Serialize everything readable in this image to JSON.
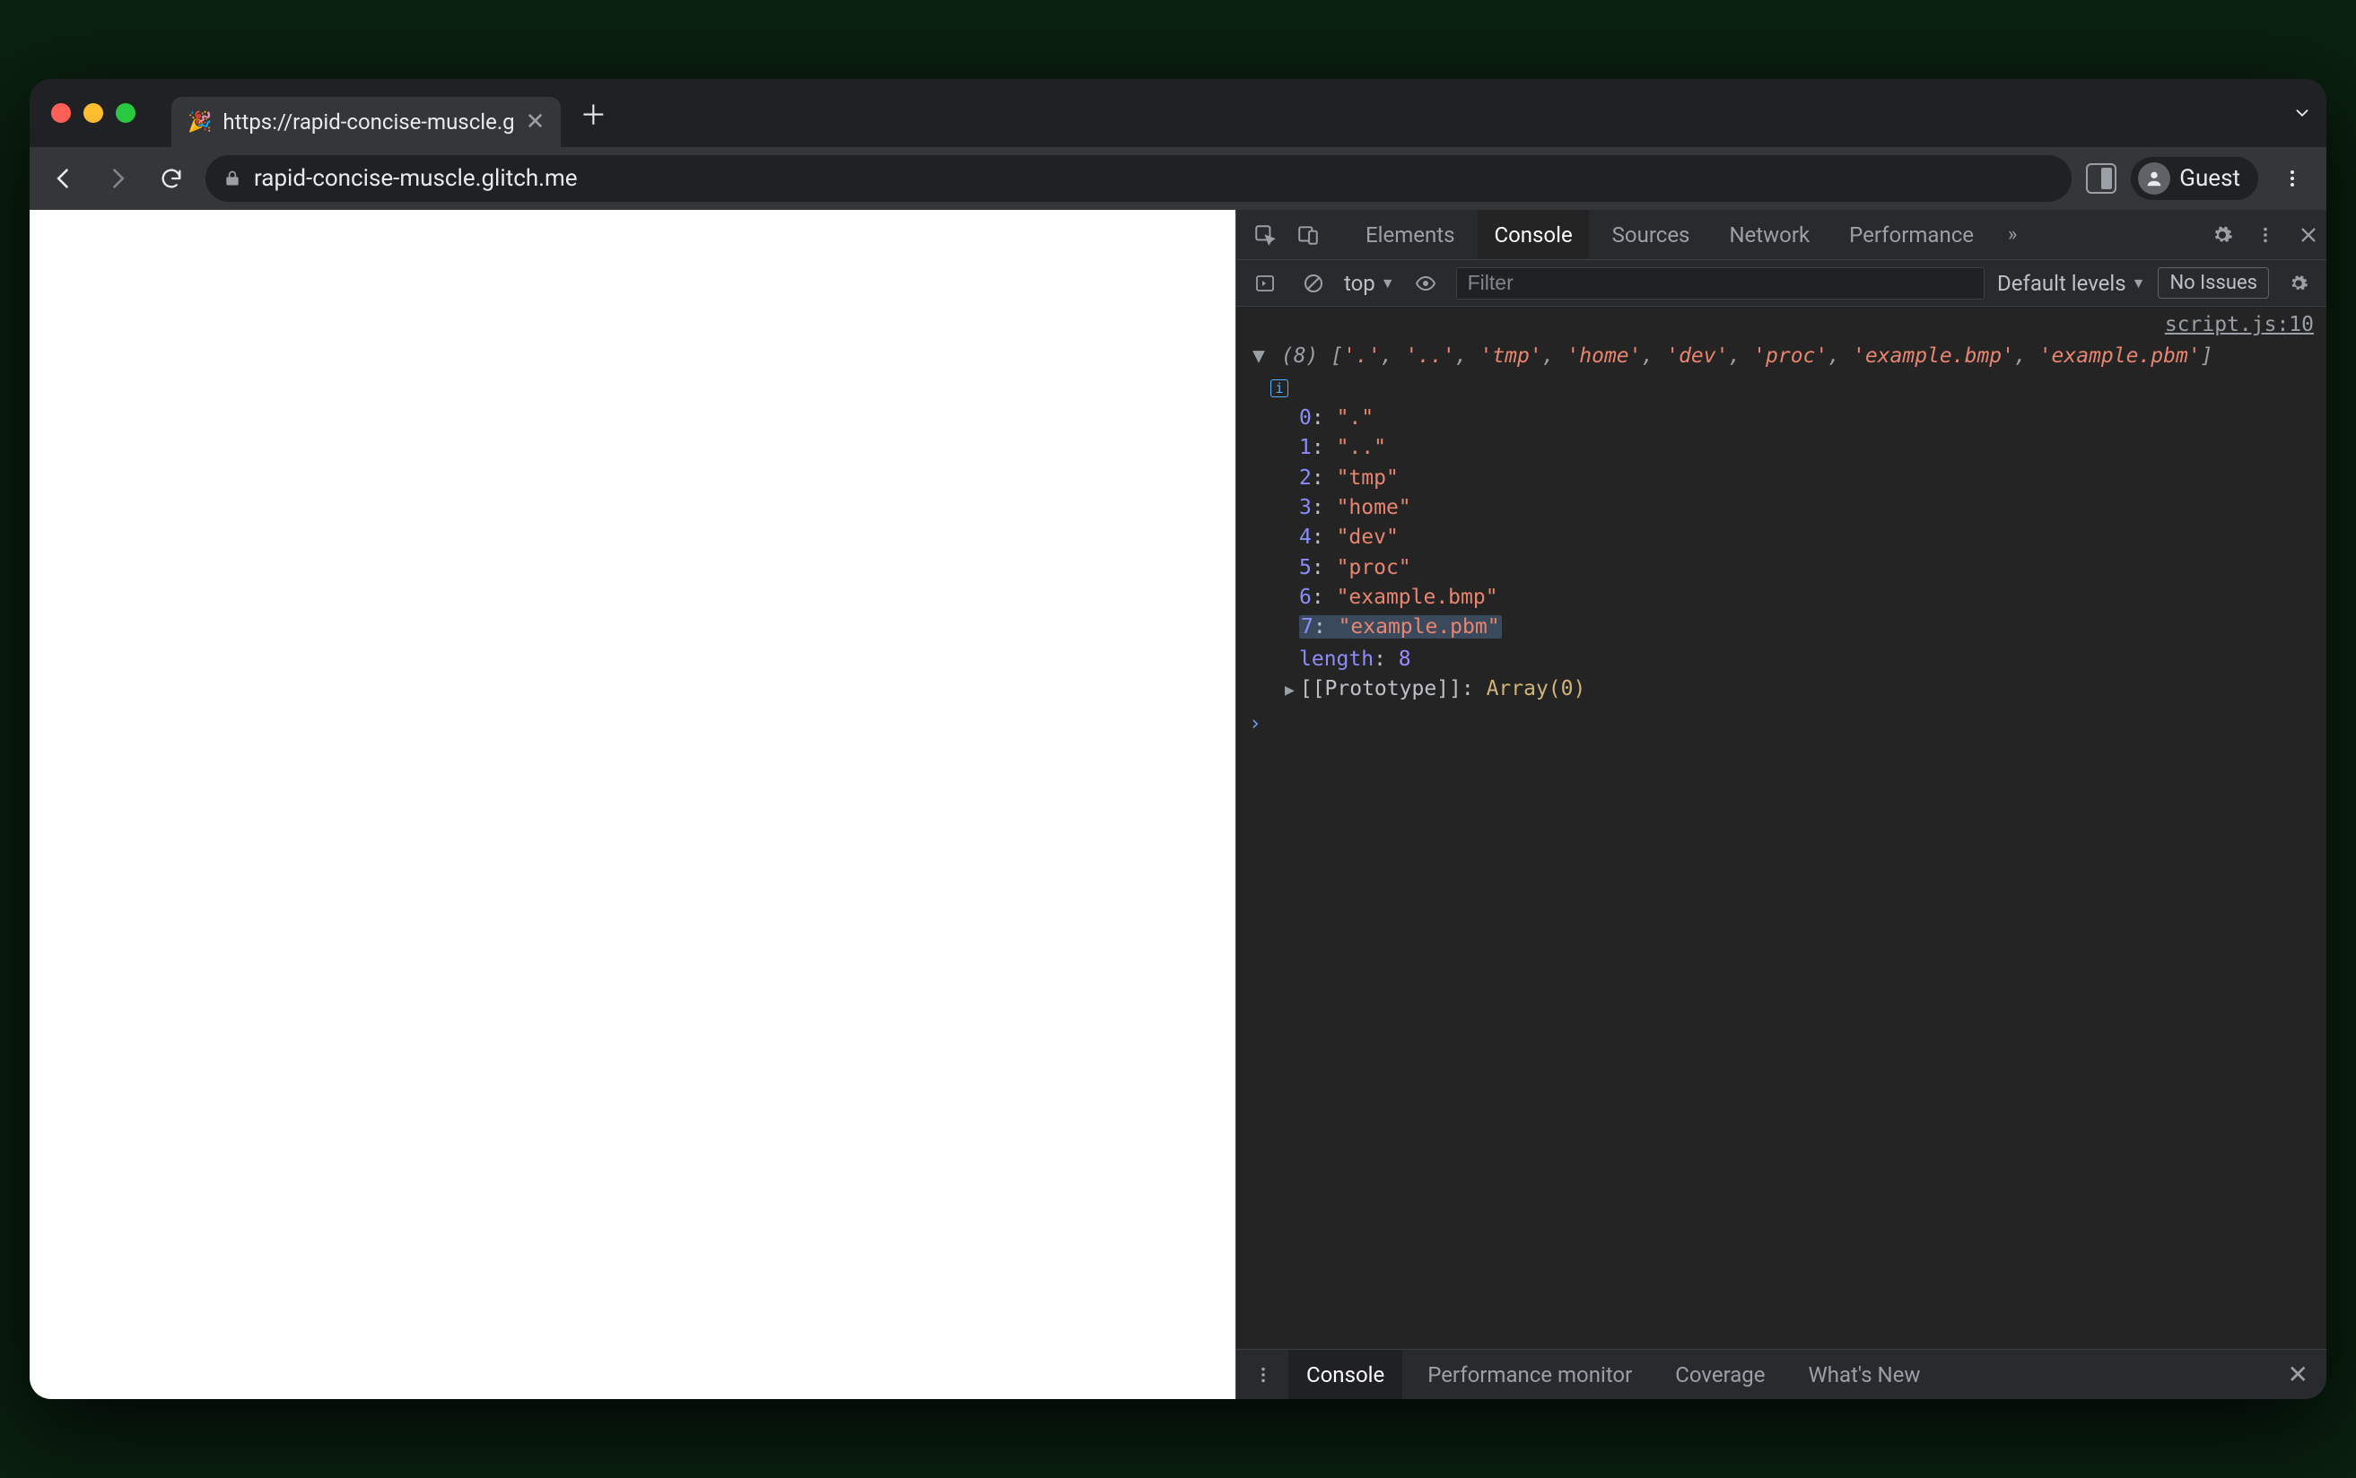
{
  "browser": {
    "tab_title": "https://rapid-concise-muscle.g",
    "favicon": "🎉",
    "url_display": "rapid-concise-muscle.glitch.me",
    "profile_label": "Guest"
  },
  "devtools": {
    "tabs": [
      "Elements",
      "Console",
      "Sources",
      "Network",
      "Performance"
    ],
    "active_tab": "Console",
    "console_toolbar": {
      "context": "top",
      "filter_placeholder": "Filter",
      "levels": "Default levels",
      "issues": "No Issues"
    },
    "source_link": "script.js:10",
    "array": {
      "length_display": "(8)",
      "summary_items": [
        ".",
        "..",
        "tmp",
        "home",
        "dev",
        "proc",
        "example.bmp",
        "example.pbm"
      ],
      "entries": [
        {
          "k": "0",
          "v": "."
        },
        {
          "k": "1",
          "v": ".."
        },
        {
          "k": "2",
          "v": "tmp"
        },
        {
          "k": "3",
          "v": "home"
        },
        {
          "k": "4",
          "v": "dev"
        },
        {
          "k": "5",
          "v": "proc"
        },
        {
          "k": "6",
          "v": "example.bmp"
        },
        {
          "k": "7",
          "v": "example.pbm"
        }
      ],
      "length": 8,
      "highlight_index": 7,
      "prototype": "Array(0)"
    },
    "drawer_tabs": [
      "Console",
      "Performance monitor",
      "Coverage",
      "What's New"
    ]
  }
}
